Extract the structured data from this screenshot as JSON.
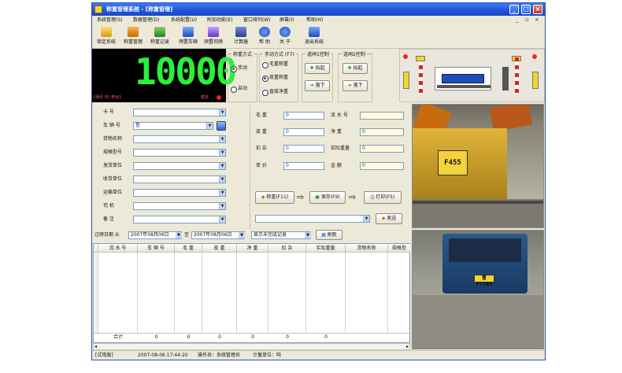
{
  "window": {
    "title": "称重管理系统 - [称重管理]"
  },
  "menu": [
    "系统管理(S)",
    "数据管理(D)",
    "系统配置(U)",
    "附加功能(E)",
    "窗口排列(W)",
    "屏幕(I)",
    "帮助(H)"
  ],
  "toolbar": {
    "items": [
      "锁定系统",
      "称重管理",
      "称重记录",
      "预置车辆",
      "预置司磅",
      "计算器",
      "帮 助",
      "关 于",
      "退出系统"
    ]
  },
  "display": {
    "weight": "10000",
    "status_left": "(通讯 可)   秤台1",
    "status_right": "稳定"
  },
  "weigh_mode": {
    "title": "称重方式",
    "options": [
      "手动",
      "自动"
    ]
  },
  "manual_mode": {
    "title": "手动方式 (F7)",
    "options": [
      "毛重称重",
      "皮重称重",
      "直接净重"
    ]
  },
  "gate1": {
    "title": "道闸1控制",
    "raise": "抬起",
    "lower": "落下"
  },
  "gate2": {
    "title": "道闸2控制",
    "raise": "抬起",
    "lower": "落下"
  },
  "form": {
    "labels": [
      "卡  号",
      "车 辆 号",
      "货物名称",
      "规格型号",
      "发货单位",
      "收货单位",
      "运输单位",
      "司  机",
      "备  注"
    ],
    "plate_value": "鲁"
  },
  "weights": {
    "gross_label": "毛  重",
    "tare_label": "皮  重",
    "deduct_label": "扣  杂",
    "price_label": "单  价",
    "serial_label": "流 水 号",
    "net_label": "净  重",
    "actual_label": "实际重量",
    "amount_label": "金  额",
    "gross": "0",
    "tare": "0",
    "deduct": "0",
    "price": "0",
    "net": "0",
    "actual": "0",
    "amount": "0"
  },
  "actions": {
    "weigh": "称重(F11)",
    "save": "保存(F9)",
    "print": "打印(F5)",
    "send": "发送"
  },
  "filter": {
    "label": "过磅日期 从",
    "from": "2007年08月06日",
    "to_label": "至",
    "to": "2007年08月06日",
    "record_type": "显示未完成记录",
    "refresh": "刷新"
  },
  "grid": {
    "columns": [
      "流 水 号",
      "车 辆 号",
      "毛  重",
      "皮  重",
      "净  重",
      "扣  杂",
      "实际重量",
      "货物名称",
      "规格型"
    ],
    "footer": {
      "label": "合计",
      "values": [
        "0",
        "0",
        "0",
        "0",
        "0",
        "0"
      ]
    }
  },
  "statusbar": {
    "mode": "[试用版]",
    "datetime": "2007-08-06   17:44:20",
    "operator": "操作员：系统管理员",
    "unit": "计量单位：吨"
  },
  "camera": {
    "plate_top": "F455",
    "plate_bottom": "鲁F7185"
  }
}
